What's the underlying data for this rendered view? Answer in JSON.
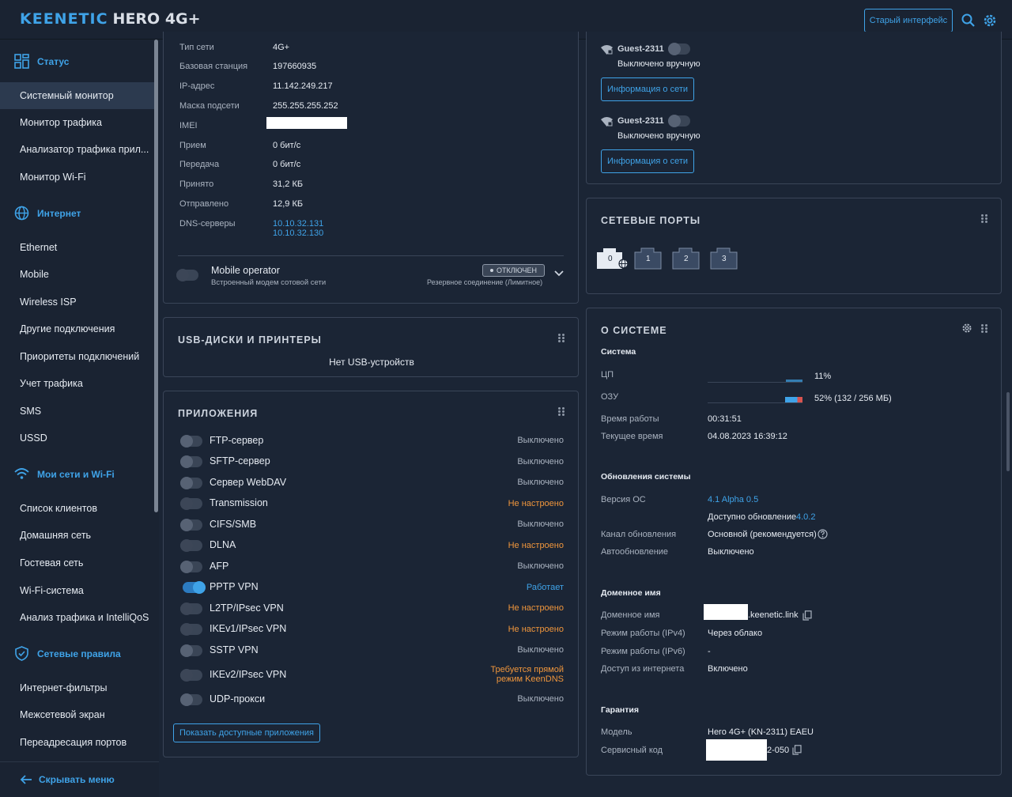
{
  "header": {
    "logo_brand": "KEENETIC",
    "logo_model": "HERO 4G+",
    "old_interface": "Старый интерфейс"
  },
  "sidebar": {
    "status_title": "Статус",
    "status_items": [
      "Системный монитор",
      "Монитор трафика",
      "Анализатор трафика прил...",
      "Монитор Wi-Fi"
    ],
    "internet_title": "Интернет",
    "internet_items": [
      "Ethernet",
      "Mobile",
      "Wireless ISP",
      "Другие подключения",
      "Приоритеты подключений",
      "Учет трафика",
      "SMS",
      "USSD"
    ],
    "wifi_title": "Мои сети и Wi-Fi",
    "wifi_items": [
      "Список клиентов",
      "Домашняя сеть",
      "Гостевая сеть",
      "Wi-Fi-система",
      "Анализ трафика и IntelliQoS"
    ],
    "rules_title": "Сетевые правила",
    "rules_items": [
      "Интернет-фильтры",
      "Межсетевой экран",
      "Переадресация портов"
    ],
    "hide_menu": "Скрывать меню"
  },
  "mobile": {
    "rows": [
      {
        "label": "Тип сети",
        "value": "4G+"
      },
      {
        "label": "Базовая станция",
        "value": "197660935"
      },
      {
        "label": "IP-адрес",
        "value": "11.142.249.217"
      },
      {
        "label": "Маска подсети",
        "value": "255.255.255.252"
      },
      {
        "label": "IMEI",
        "value": ""
      },
      {
        "label": "Прием",
        "value": "0 бит/с"
      },
      {
        "label": "Передача",
        "value": "0 бит/с"
      },
      {
        "label": "Принято",
        "value": "31,2 КБ"
      },
      {
        "label": "Отправлено",
        "value": "12,9 КБ"
      },
      {
        "label": "DNS-серверы",
        "value": "10.10.32.131"
      }
    ],
    "dns2": "10.10.32.130",
    "operator_name": "Mobile operator",
    "operator_sub": "Встроенный модем сотовой сети",
    "operator_badge": "ОТКЛЮЧЕН",
    "operator_backup": "Резервное соединение (Лимитное)"
  },
  "usb": {
    "title": "USB-ДИСКИ И ПРИНТЕРЫ",
    "empty": "Нет USB-устройств"
  },
  "apps": {
    "title": "ПРИЛОЖЕНИЯ",
    "items": [
      {
        "name": "FTP-сервер",
        "status": "Выключено"
      },
      {
        "name": "SFTP-сервер",
        "status": "Выключено"
      },
      {
        "name": "Сервер WebDAV",
        "status": "Выключено"
      },
      {
        "name": "Transmission",
        "status": "Не настроено"
      },
      {
        "name": "CIFS/SMB",
        "status": "Выключено"
      },
      {
        "name": "DLNA",
        "status": "Не настроено"
      },
      {
        "name": "AFP",
        "status": "Выключено"
      },
      {
        "name": "PPTP VPN",
        "status": "Работает"
      },
      {
        "name": "L2TP/IPsec VPN",
        "status": "Не настроено"
      },
      {
        "name": "IKEv1/IPsec VPN",
        "status": "Не настроено"
      },
      {
        "name": "SSTP VPN",
        "status": "Выключено"
      },
      {
        "name": "IKEv2/IPsec VPN",
        "status": "Требуется прямой"
      },
      {
        "name": "UDP-прокси",
        "status": "Выключено"
      }
    ],
    "ikev2_status_line2": "режим KeenDNS",
    "show_button": "Показать доступные приложения"
  },
  "guest": {
    "networks": [
      {
        "name": "Guest-2311",
        "state": "Выключено вручную",
        "button": "Информация о сети"
      },
      {
        "name": "Guest-2311",
        "state": "Выключено вручную",
        "button": "Информация о сети"
      }
    ]
  },
  "ports": {
    "title": "СЕТЕВЫЕ ПОРТЫ",
    "labels": [
      "0",
      "1",
      "2",
      "3"
    ]
  },
  "system": {
    "title": "О СИСТЕМЕ",
    "sys_head": "Система",
    "cpu_label": "ЦП",
    "cpu_value": "11%",
    "cpu_percent": 11,
    "ram_label": "ОЗУ",
    "ram_value": "52% (132 / 256 МБ)",
    "ram_percent": 52,
    "uptime_label": "Время работы",
    "uptime_value": "00:31:51",
    "time_label": "Текущее время",
    "time_value": "04.08.2023 16:39:12",
    "updates_head": "Обновления системы",
    "os_label": "Версия ОС",
    "os_value": "4.1 Alpha 0.5",
    "update_avail_prefix": "Доступно обновление",
    "update_avail_version": "4.0.2",
    "channel_label": "Канал обновления",
    "channel_value": "Основной (рекомендуется)",
    "auto_label": "Автообновление",
    "auto_value": "Выключено",
    "domain_head": "Доменное имя",
    "domain_label": "Доменное имя",
    "domain_value": ".keenetic.link",
    "ipv4_label": "Режим работы (IPv4)",
    "ipv4_value": "Через облако",
    "ipv6_label": "Режим работы (IPv6)",
    "ipv6_value": "-",
    "access_label": "Доступ из интернета",
    "access_value": "Включено",
    "warranty_head": "Гарантия",
    "model_label": "Модель",
    "model_value": "Hero 4G+ (KN-2311) EAEU",
    "service_label": "Сервисный код",
    "service_value": "2-050"
  },
  "colors": {
    "accent": "#3fa3e8",
    "warn": "#f0963c",
    "bg": "#1b2535"
  }
}
